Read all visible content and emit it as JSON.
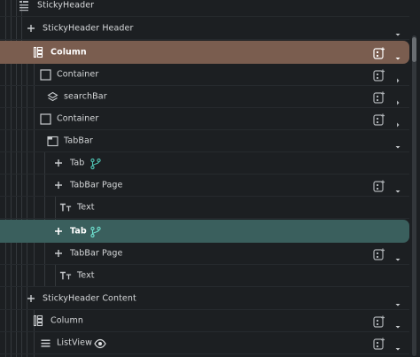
{
  "colors": {
    "background": "#1c1f22",
    "selected_primary": "#7a5d4f",
    "selected_secondary": "#3a5f5d",
    "accent_teal": "#4fc3b3"
  },
  "tree": {
    "sticky_header": {
      "label": "StickyHeader",
      "icon": "sticky-header-icon"
    },
    "sticky_header_header": {
      "label": "StickyHeader Header",
      "icon": "plus-icon"
    },
    "column_1": {
      "label": "Column",
      "icon": "column-icon"
    },
    "container_1": {
      "label": "Container",
      "icon": "container-icon"
    },
    "search_bar": {
      "label": "searchBar",
      "icon": "layers-icon"
    },
    "container_2": {
      "label": "Container",
      "icon": "container-icon"
    },
    "tab_bar": {
      "label": "TabBar",
      "icon": "tabbar-icon"
    },
    "tab_1": {
      "label": "Tab",
      "icon": "plus-icon",
      "badge": "branch-icon"
    },
    "tabbar_page_1": {
      "label": "TabBar Page",
      "icon": "plus-icon"
    },
    "text_1": {
      "label": "Text",
      "icon": "text-icon"
    },
    "tab_2": {
      "label": "Tab",
      "icon": "plus-icon",
      "badge": "branch-icon"
    },
    "tabbar_page_2": {
      "label": "TabBar Page",
      "icon": "plus-icon"
    },
    "text_2": {
      "label": "Text",
      "icon": "text-icon"
    },
    "sticky_header_content": {
      "label": "StickyHeader Content",
      "icon": "plus-icon"
    },
    "column_2": {
      "label": "Column",
      "icon": "column-icon"
    },
    "list_view": {
      "label": "ListView",
      "icon": "listview-icon",
      "badge": "eye-icon"
    }
  }
}
